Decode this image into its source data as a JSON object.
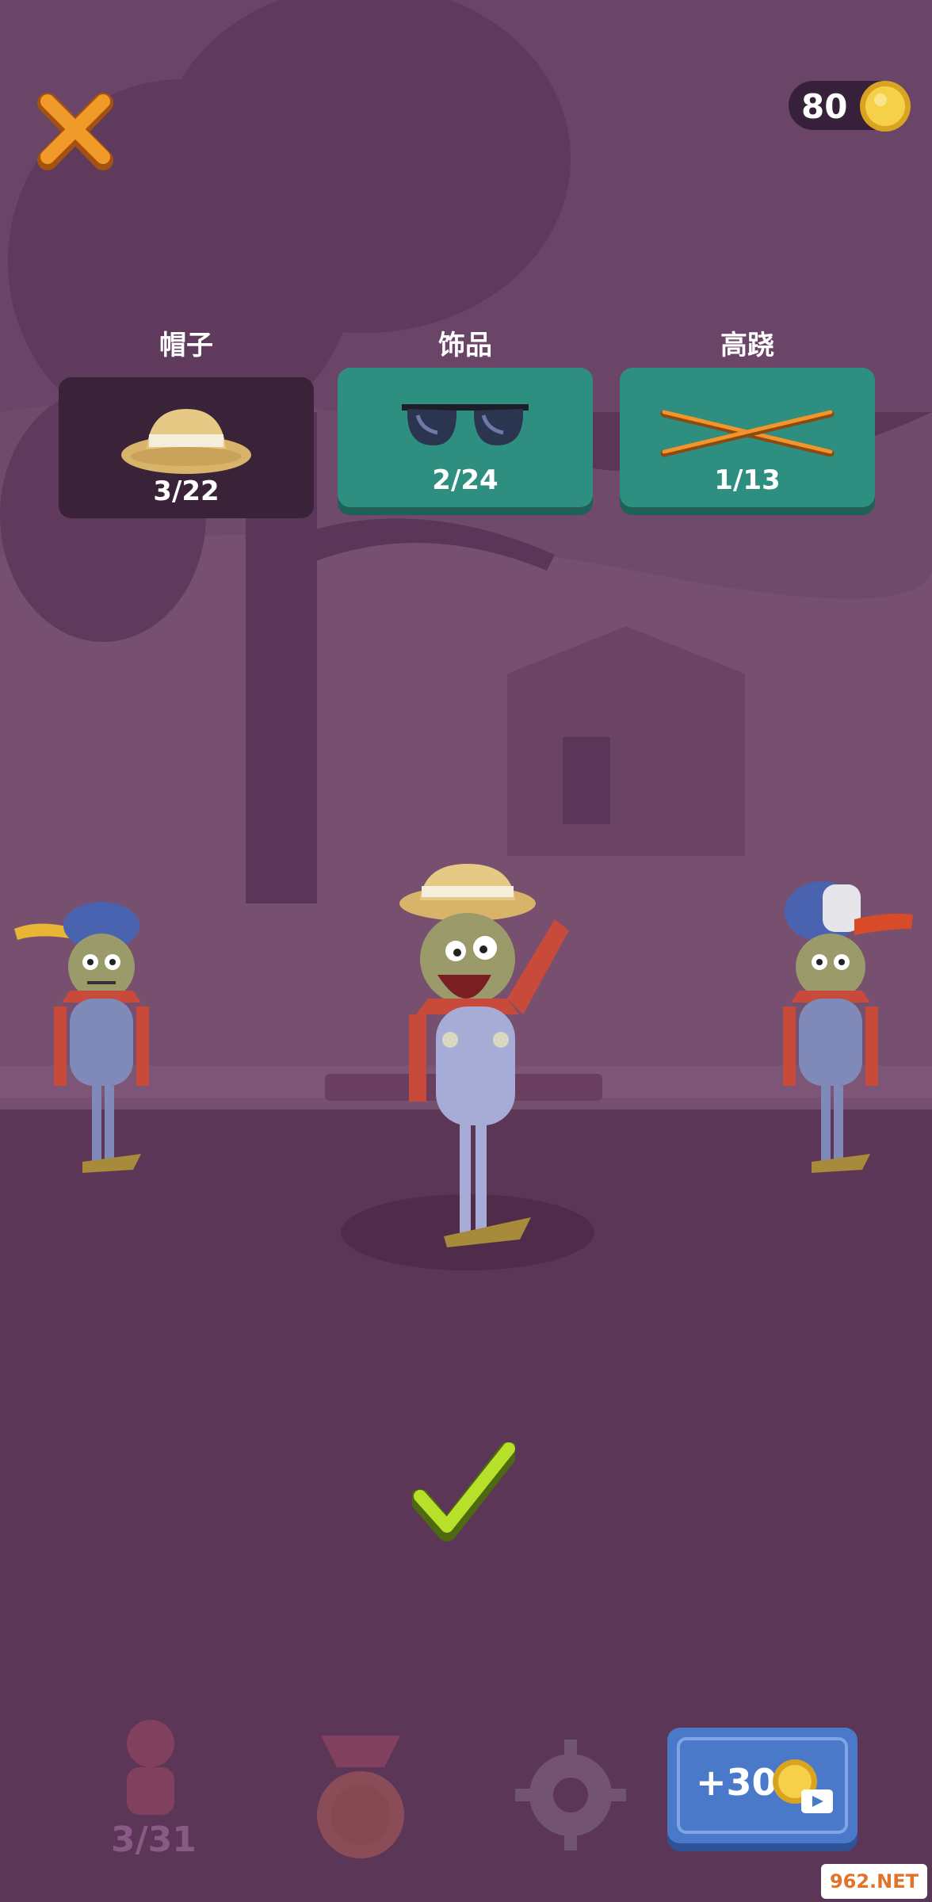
{
  "header": {
    "coins": "80"
  },
  "categories": [
    {
      "label": "帽子",
      "progress": "3/22",
      "icon": "straw-hat-icon",
      "active": true
    },
    {
      "label": "饰品",
      "progress": "2/24",
      "icon": "sunglasses-icon",
      "active": false
    },
    {
      "label": "高跷",
      "progress": "1/13",
      "icon": "stilts-icon",
      "active": false
    }
  ],
  "bottom_nav": {
    "characters_progress": "3/31",
    "bonus_label": "+30"
  },
  "watermark": "962.NET",
  "colors": {
    "background": "#5c3657",
    "tab_active": "#3a2239",
    "tab_inactive": "#2e8f80",
    "bonus_button": "#4a79c9",
    "confirm": "#b6e02a",
    "close": "#e8891f",
    "coin": "#f1c232"
  }
}
